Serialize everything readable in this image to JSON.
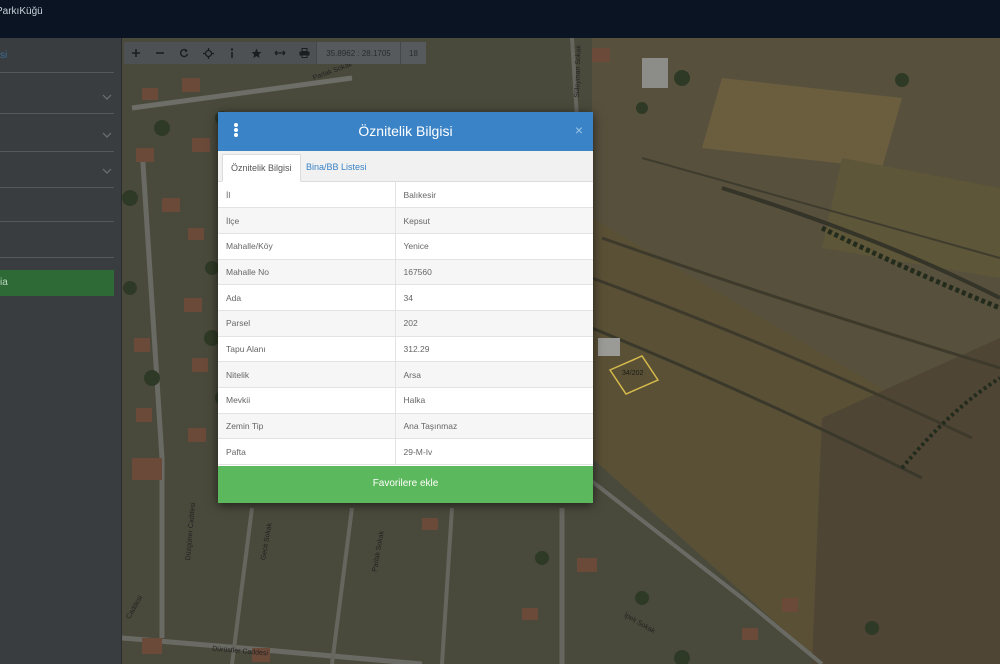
{
  "app": {
    "brand": "ParkıKüğü"
  },
  "left_panel": {
    "link_label": "si",
    "primary_button_label": "ia"
  },
  "map_toolbar": {
    "coordinates": "35.8962 : 28.1705",
    "zoom_level": "18"
  },
  "map": {
    "street_labels": [
      "Parlak Sokak",
      "Süleyman Sokak",
      "Düzgüner Caddesi",
      "Gecit Sokak",
      "Parlak Sokak",
      "Dürüstler Caddesi",
      "İpek Sokak",
      "Caddesi"
    ],
    "parcel_label": "34/202"
  },
  "modal": {
    "title": "Öznitelik Bilgisi",
    "close_glyph": "×",
    "tabs": [
      {
        "label": "Öznitelik Bilgisi",
        "active": true
      },
      {
        "label": "Bina/BB Listesi",
        "active": false
      }
    ],
    "rows": [
      {
        "key": "İl",
        "value": "Balıkesir"
      },
      {
        "key": "İlçe",
        "value": "Kepsut"
      },
      {
        "key": "Mahalle/Köy",
        "value": "Yenice"
      },
      {
        "key": "Mahalle No",
        "value": "167560"
      },
      {
        "key": "Ada",
        "value": "34"
      },
      {
        "key": "Parsel",
        "value": "202"
      },
      {
        "key": "Tapu Alanı",
        "value": "312.29"
      },
      {
        "key": "Nitelik",
        "value": "Arsa"
      },
      {
        "key": "Mevkii",
        "value": "Halka"
      },
      {
        "key": "Zemin Tip",
        "value": "Ana Taşınmaz"
      },
      {
        "key": "Pafta",
        "value": "29-M-Iv"
      }
    ],
    "favorite_button_label": "Favorilere ekle"
  },
  "colors": {
    "header_blue": "#3a83c6",
    "success_green": "#5cb85c",
    "topbar": "#0a1422"
  },
  "icons": [
    "kebab-menu-icon",
    "close-icon",
    "plus-icon",
    "minus-icon",
    "refresh-icon",
    "locate-icon",
    "info-icon",
    "star-icon",
    "measure-icon",
    "print-icon",
    "chevron-down-icon"
  ]
}
